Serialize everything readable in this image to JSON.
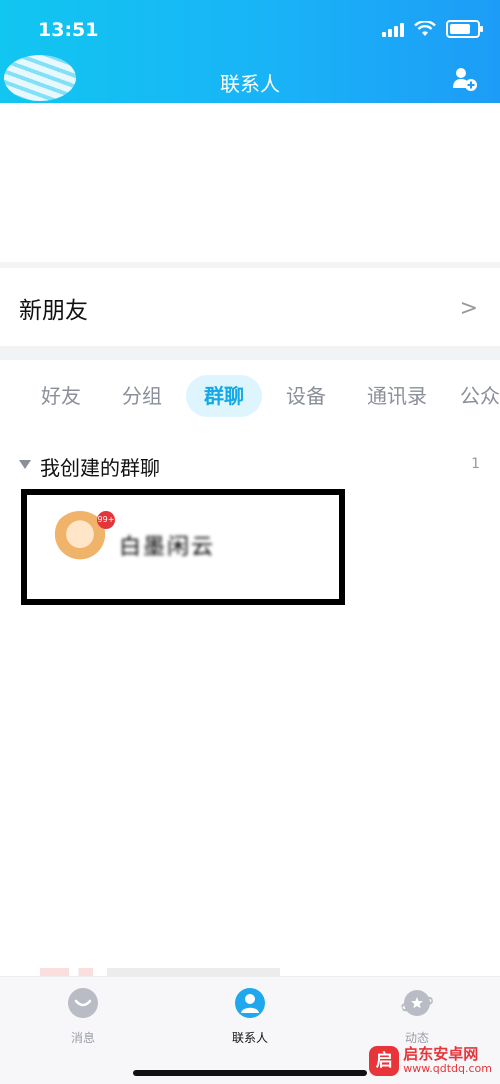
{
  "status_bar": {
    "time": "13:51"
  },
  "header": {
    "title": "联系人"
  },
  "new_friends": {
    "label": "新朋友",
    "chevron": ">"
  },
  "tabs": [
    {
      "label": "好友",
      "active": false
    },
    {
      "label": "分组",
      "active": false
    },
    {
      "label": "群聊",
      "active": true
    },
    {
      "label": "设备",
      "active": false
    },
    {
      "label": "通讯录",
      "active": false
    },
    {
      "label": "公众",
      "active": false
    }
  ],
  "group_section": {
    "title": "我创建的群聊",
    "count": "1"
  },
  "group_item": {
    "name": "白墨闲云",
    "badge": "99+"
  },
  "tabbar": [
    {
      "label": "消息",
      "icon": "message-icon",
      "active": false
    },
    {
      "label": "联系人",
      "icon": "contacts-icon",
      "active": true
    },
    {
      "label": "动态",
      "icon": "planet-icon",
      "active": false
    }
  ],
  "watermark": {
    "logo": "启",
    "main": "启东安卓网",
    "url": "www.qdtdq.com"
  },
  "colors": {
    "accent": "#12a9e6",
    "header_gradient_start": "#11c6f0",
    "header_gradient_end": "#1d9cf7"
  }
}
